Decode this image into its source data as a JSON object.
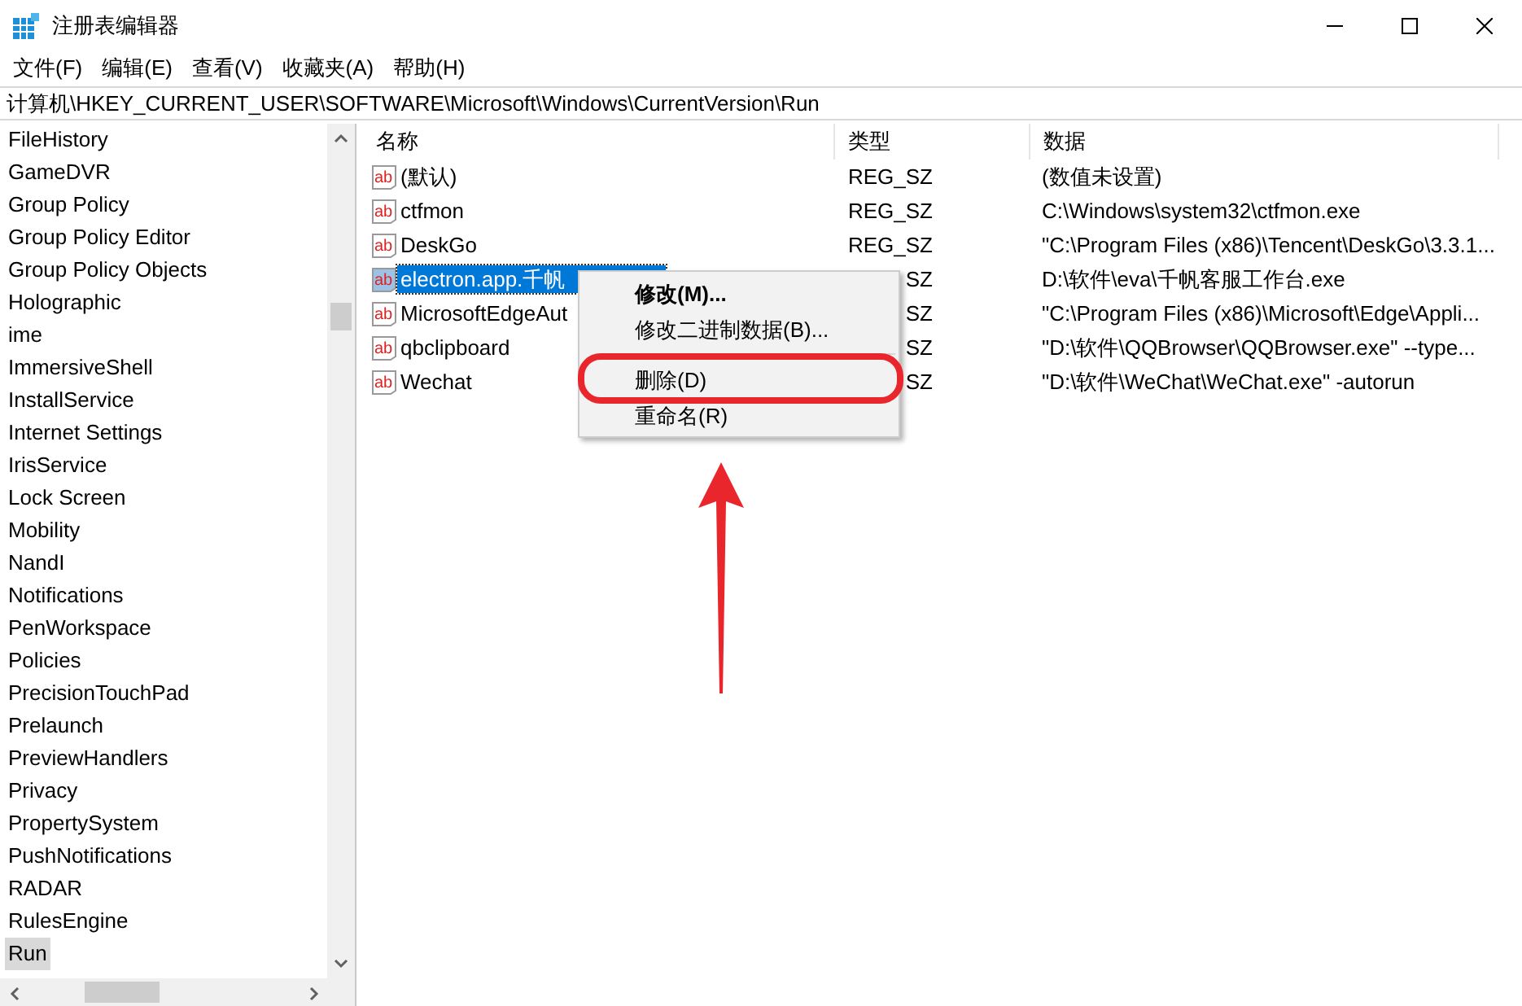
{
  "window": {
    "title": "注册表编辑器"
  },
  "menu": [
    "文件(F)",
    "编辑(E)",
    "查看(V)",
    "收藏夹(A)",
    "帮助(H)"
  ],
  "address": "计算机\\HKEY_CURRENT_USER\\SOFTWARE\\Microsoft\\Windows\\CurrentVersion\\Run",
  "tree": [
    {
      "label": "FileHistory",
      "selected": false
    },
    {
      "label": "GameDVR",
      "selected": false
    },
    {
      "label": "Group Policy",
      "selected": false
    },
    {
      "label": "Group Policy Editor",
      "selected": false
    },
    {
      "label": "Group Policy Objects",
      "selected": false
    },
    {
      "label": "Holographic",
      "selected": false
    },
    {
      "label": "ime",
      "selected": false
    },
    {
      "label": "ImmersiveShell",
      "selected": false
    },
    {
      "label": "InstallService",
      "selected": false
    },
    {
      "label": "Internet Settings",
      "selected": false
    },
    {
      "label": "IrisService",
      "selected": false
    },
    {
      "label": "Lock Screen",
      "selected": false
    },
    {
      "label": "Mobility",
      "selected": false
    },
    {
      "label": "NandI",
      "selected": false
    },
    {
      "label": "Notifications",
      "selected": false
    },
    {
      "label": "PenWorkspace",
      "selected": false
    },
    {
      "label": "Policies",
      "selected": false
    },
    {
      "label": "PrecisionTouchPad",
      "selected": false
    },
    {
      "label": "Prelaunch",
      "selected": false
    },
    {
      "label": "PreviewHandlers",
      "selected": false
    },
    {
      "label": "Privacy",
      "selected": false
    },
    {
      "label": "PropertySystem",
      "selected": false
    },
    {
      "label": "PushNotifications",
      "selected": false
    },
    {
      "label": "RADAR",
      "selected": false
    },
    {
      "label": "RulesEngine",
      "selected": false
    },
    {
      "label": "Run",
      "selected": true
    }
  ],
  "table": {
    "columns": [
      "名称",
      "类型",
      "数据"
    ],
    "rows": [
      {
        "icon": "ab",
        "name": "(默认)",
        "type": "REG_SZ",
        "data": "(数值未设置)",
        "selected": false
      },
      {
        "icon": "ab",
        "name": "ctfmon",
        "type": "REG_SZ",
        "data": "C:\\Windows\\system32\\ctfmon.exe",
        "selected": false
      },
      {
        "icon": "ab",
        "name": "DeskGo",
        "type": "REG_SZ",
        "data": "\"C:\\Program Files (x86)\\Tencent\\DeskGo\\3.3.1...",
        "selected": false
      },
      {
        "icon": "ab",
        "name": "electron.app.千帆",
        "type": "SZ",
        "data": "D:\\软件\\eva\\千帆客服工作台.exe",
        "selected": true
      },
      {
        "icon": "ab",
        "name": "MicrosoftEdgeAut",
        "type": "SZ",
        "data": "\"C:\\Program Files (x86)\\Microsoft\\Edge\\Appli...",
        "selected": false
      },
      {
        "icon": "ab",
        "name": "qbclipboard",
        "type": "SZ",
        "data": "\"D:\\软件\\QQBrowser\\QQBrowser.exe\" --type...",
        "selected": false
      },
      {
        "icon": "ab",
        "name": "Wechat",
        "type": "SZ",
        "data": "\"D:\\软件\\WeChat\\WeChat.exe\" -autorun",
        "selected": false
      }
    ]
  },
  "context_menu": [
    {
      "label": "修改(M)...",
      "kind": "default",
      "highlighted": false
    },
    {
      "label": "修改二进制数据(B)...",
      "kind": "item",
      "highlighted": false
    },
    {
      "kind": "separator"
    },
    {
      "label": "删除(D)",
      "kind": "item",
      "highlighted": true
    },
    {
      "label": "重命名(R)",
      "kind": "item",
      "highlighted": false
    }
  ]
}
